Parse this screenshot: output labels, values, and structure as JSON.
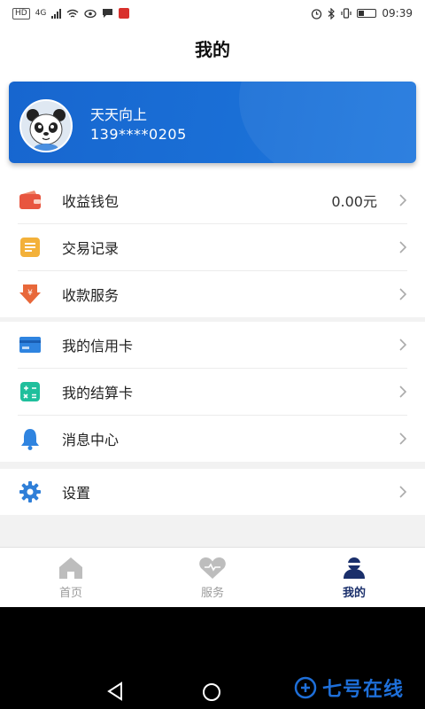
{
  "status_bar": {
    "left_badge": "HD",
    "network": "4G",
    "time": "09:39"
  },
  "header": {
    "title": "我的"
  },
  "profile": {
    "name": "天天向上",
    "phone": "139****0205"
  },
  "menu_group_1": [
    {
      "label": "收益钱包",
      "value": "0.00元",
      "icon": "wallet-icon",
      "color": "#e8553f"
    },
    {
      "label": "交易记录",
      "icon": "record-icon",
      "color": "#f3b13a"
    },
    {
      "label": "收款服务",
      "icon": "payment-service-icon",
      "color": "#e8683a"
    }
  ],
  "menu_group_2": [
    {
      "label": "我的信用卡",
      "icon": "credit-card-icon",
      "color": "#2f84e0"
    },
    {
      "label": "我的结算卡",
      "icon": "calculator-icon",
      "color": "#1fbf9c"
    },
    {
      "label": "消息中心",
      "icon": "bell-icon",
      "color": "#2f84e0"
    }
  ],
  "menu_group_3": [
    {
      "label": "设置",
      "icon": "gear-icon",
      "color": "#2f7fd8"
    }
  ],
  "tabbar": [
    {
      "label": "首页",
      "icon": "home-icon",
      "active": false
    },
    {
      "label": "服务",
      "icon": "heart-icon",
      "active": false
    },
    {
      "label": "我的",
      "icon": "user-icon",
      "active": true
    }
  ],
  "watermark": {
    "text": "七号在线"
  },
  "colors": {
    "card_blue": "#1766cf",
    "active_tab": "#1a2f6b",
    "inactive_tab": "#9a9a9a"
  }
}
